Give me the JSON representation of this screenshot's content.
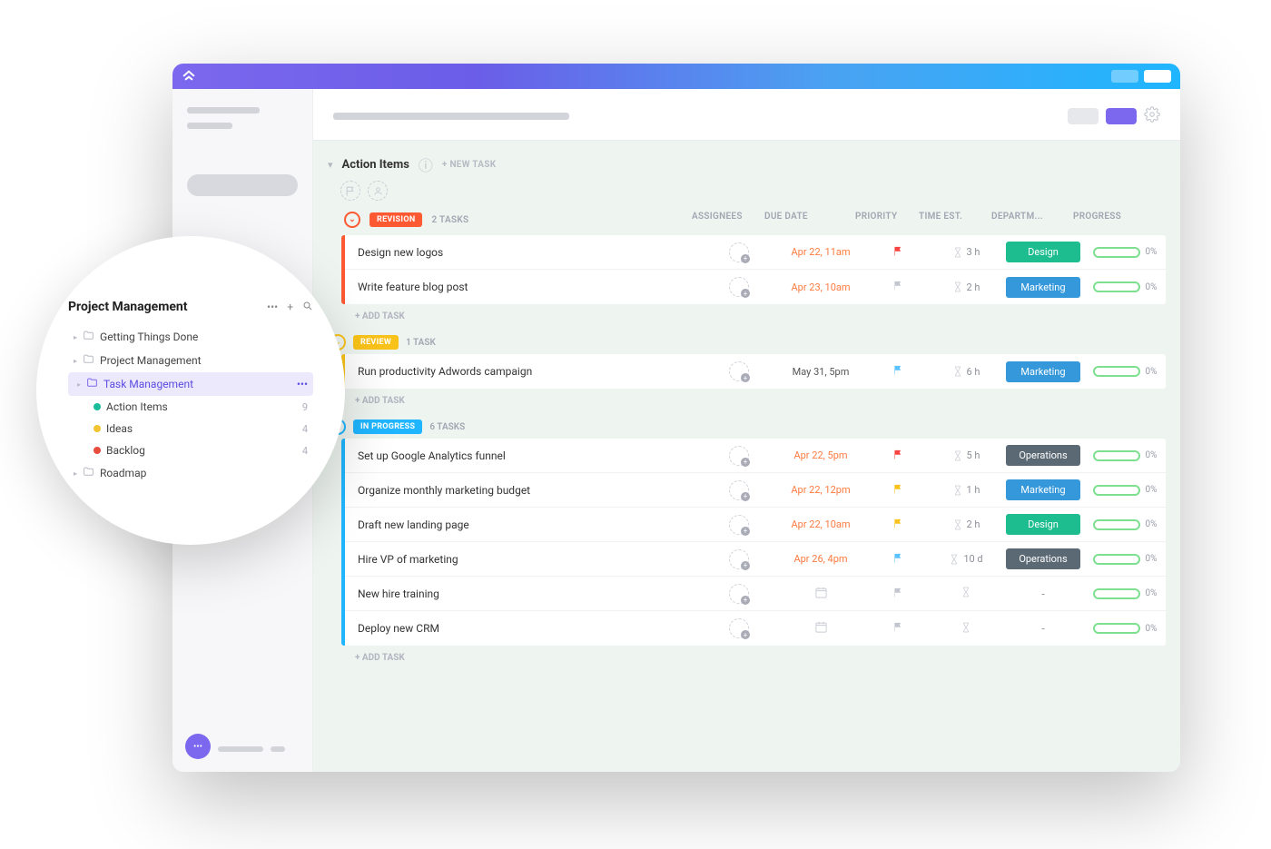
{
  "titlebar": {
    "brand_glyph": "◆"
  },
  "list": {
    "title": "Action Items",
    "new_task_label": "+ NEW TASK",
    "add_task_label": "+ ADD TASK"
  },
  "columns": {
    "assignees": "ASSIGNEES",
    "due_date": "DUE DATE",
    "priority": "PRIORITY",
    "time_est": "TIME EST.",
    "department": "DEPARTM...",
    "progress": "PROGRESS"
  },
  "groups": [
    {
      "name": "REVISION",
      "color": "#fd5a33",
      "count_label": "2 TASKS",
      "tasks": [
        {
          "title": "Design new logos",
          "due": "Apr 22, 11am",
          "due_color": "orange",
          "flag": "red",
          "time": "3 h",
          "dept": "Design",
          "progress": "0%"
        },
        {
          "title": "Write feature blog post",
          "due": "Apr 23, 10am",
          "due_color": "orange",
          "flag": "gray",
          "time": "2 h",
          "dept": "Marketing",
          "progress": "0%"
        }
      ]
    },
    {
      "name": "REVIEW",
      "color": "#f9c21a",
      "count_label": "1 TASK",
      "tasks": [
        {
          "title": "Run productivity Adwords campaign",
          "due": "May 31, 5pm",
          "due_color": "gray",
          "flag": "blue",
          "time": "6 h",
          "dept": "Marketing",
          "progress": "0%"
        }
      ]
    },
    {
      "name": "IN PROGRESS",
      "color": "#1fb6ff",
      "count_label": "6 TASKS",
      "tasks": [
        {
          "title": "Set up Google Analytics funnel",
          "due": "Apr 22, 5pm",
          "due_color": "orange",
          "flag": "red",
          "time": "5 h",
          "dept": "Operations",
          "progress": "0%"
        },
        {
          "title": "Organize monthly marketing budget",
          "due": "Apr 22, 12pm",
          "due_color": "orange",
          "flag": "yellow",
          "time": "1 h",
          "dept": "Marketing",
          "progress": "0%"
        },
        {
          "title": "Draft new landing page",
          "due": "Apr 22, 10am",
          "due_color": "orange",
          "flag": "yellow",
          "time": "2 h",
          "dept": "Design",
          "progress": "0%"
        },
        {
          "title": "Hire VP of marketing",
          "due": "Apr 26, 4pm",
          "due_color": "orange",
          "flag": "blue",
          "time": "10 d",
          "dept": "Operations",
          "progress": "0%"
        },
        {
          "title": "New hire training",
          "due": "",
          "due_color": "cal",
          "flag": "gray",
          "time": "",
          "dept": "-",
          "progress": "0%"
        },
        {
          "title": "Deploy new CRM",
          "due": "",
          "due_color": "cal",
          "flag": "gray",
          "time": "",
          "dept": "-",
          "progress": "0%"
        }
      ]
    }
  ],
  "popover": {
    "title": "Project Management",
    "folders": [
      {
        "label": "Getting Things Done",
        "type": "folder"
      },
      {
        "label": "Project Management",
        "type": "folder"
      },
      {
        "label": "Task Management",
        "type": "folder",
        "selected": true,
        "more": true
      },
      {
        "label": "Action Items",
        "type": "list",
        "dot": "green",
        "count": "9"
      },
      {
        "label": "Ideas",
        "type": "list",
        "dot": "yellow",
        "count": "4"
      },
      {
        "label": "Backlog",
        "type": "list",
        "dot": "red",
        "count": "4"
      },
      {
        "label": "Roadmap",
        "type": "folder"
      }
    ]
  }
}
